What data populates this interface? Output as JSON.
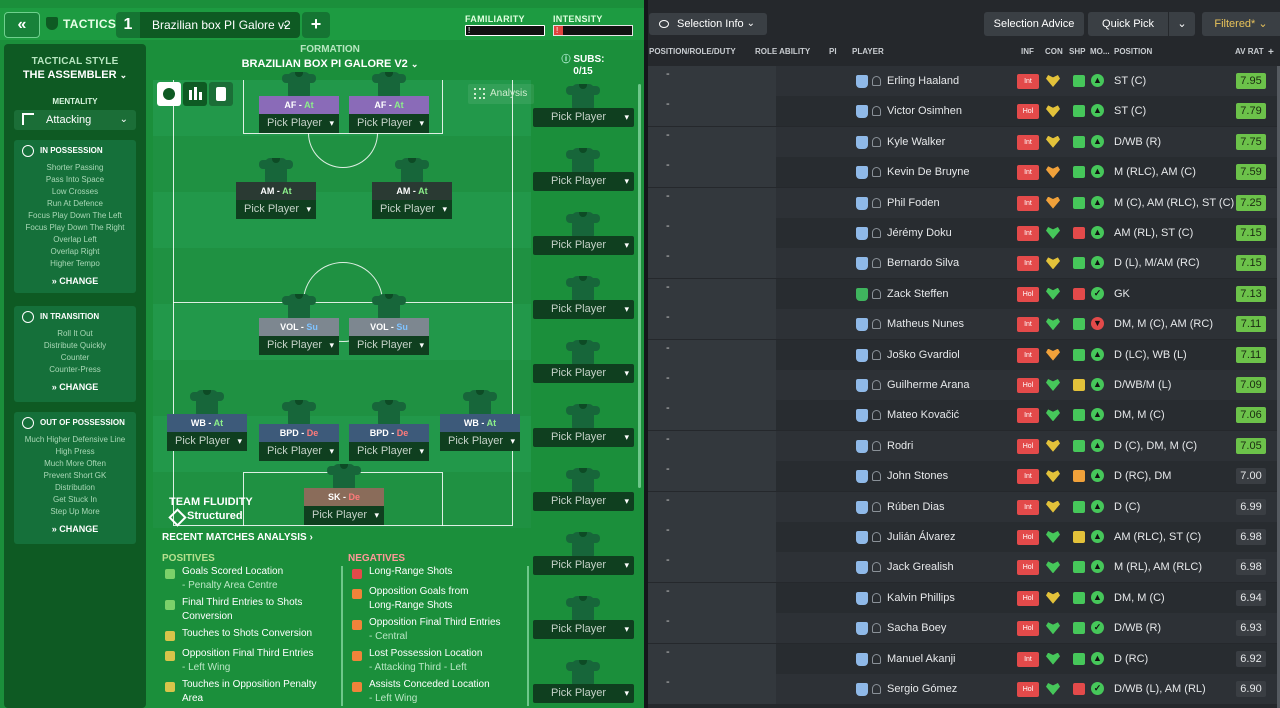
{
  "header": {
    "back_label": "«",
    "tactics_label": "TACTICS",
    "slot_number": "1",
    "tactic_name": "Brazilian box PI Galore v2",
    "add_label": "+",
    "familiarity_label": "FAMILIARITY",
    "familiarity_value": "!",
    "intensity_label": "INTENSITY",
    "intensity_value": "!",
    "intensity_level": 0.12
  },
  "style": {
    "label": "TACTICAL STYLE",
    "name": "THE ASSEMBLER",
    "mentality_label": "MENTALITY",
    "mentality_value": "Attacking",
    "in_possession": {
      "title": "IN POSSESSION",
      "items": [
        "Shorter Passing",
        "Pass Into Space",
        "Low Crosses",
        "Run At Defence",
        "Focus Play Down The Left",
        "Focus Play Down The Right",
        "Overlap Left",
        "Overlap Right",
        "Higher Tempo"
      ],
      "change": "CHANGE"
    },
    "in_transition": {
      "title": "IN TRANSITION",
      "items": [
        "Roll It Out",
        "Distribute Quickly",
        "Counter",
        "Counter-Press"
      ],
      "change": "CHANGE"
    },
    "out_of_possession": {
      "title": "OUT OF POSSESSION",
      "items": [
        "Much Higher Defensive Line",
        "High Press",
        "Much More Often",
        "Prevent Short GK",
        "Distribution",
        "Get Stuck In",
        "Step Up More"
      ],
      "change": "CHANGE"
    }
  },
  "formation": {
    "label": "FORMATION",
    "name": "BRAZILIAN BOX PI GALORE V2",
    "analysis_label": "Analysis",
    "subs_label": "SUBS:",
    "subs_count": "0/15",
    "pick_label": "Pick Player",
    "positions": [
      {
        "role": "AF",
        "duty": "At"
      },
      {
        "role": "AF",
        "duty": "At"
      },
      {
        "role": "AM",
        "duty": "At"
      },
      {
        "role": "AM",
        "duty": "At"
      },
      {
        "role": "VOL",
        "duty": "Su"
      },
      {
        "role": "VOL",
        "duty": "Su"
      },
      {
        "role": "WB",
        "duty": "At"
      },
      {
        "role": "BPD",
        "duty": "De"
      },
      {
        "role": "BPD",
        "duty": "De"
      },
      {
        "role": "WB",
        "duty": "At"
      },
      {
        "role": "SK",
        "duty": "De"
      }
    ],
    "fluidity_label": "TEAM FLUIDITY",
    "fluidity_value": "Structured"
  },
  "analysis": {
    "title": "RECENT MATCHES ANALYSIS",
    "positives_label": "POSITIVES",
    "negatives_label": "NEGATIVES",
    "positives": [
      {
        "text": "Goals Scored Location",
        "sub": "- Penalty Area Centre"
      },
      {
        "text": "Final Third Entries to Shots",
        "sub": "Conversion"
      },
      {
        "text": "Touches to Shots Conversion",
        "sub": ""
      },
      {
        "text": "Opposition Final Third Entries",
        "sub": "- Left Wing"
      },
      {
        "text": "Touches in Opposition Penalty",
        "sub": "Area"
      }
    ],
    "negatives": [
      {
        "text": "Long-Range Shots",
        "sub": ""
      },
      {
        "text": "Opposition Goals from",
        "sub": "Long-Range Shots"
      },
      {
        "text": "Opposition Final Third Entries",
        "sub": "- Central"
      },
      {
        "text": "Lost Possession Location",
        "sub": "- Attacking Third - Left"
      },
      {
        "text": "Assists Conceded Location",
        "sub": "- Left Wing"
      }
    ]
  },
  "selection": {
    "info_label": "Selection Info",
    "advice_label": "Selection Advice",
    "quick_pick_label": "Quick Pick",
    "filtered_label": "Filtered*",
    "columns": {
      "position": "POSITION/ROLE/DUTY",
      "role_ability": "ROLE ABILITY",
      "pi": "PI",
      "player": "PLAYER",
      "inf": "INF",
      "con": "CON",
      "shp": "SHP",
      "mor": "MO...",
      "pos": "POSITION",
      "rating": "AV RAT"
    },
    "players": [
      {
        "name": "Erling Haaland",
        "inf": "Int",
        "con": "yellow",
        "shp": "green",
        "mor": "up",
        "pos": "ST (C)",
        "rating": "7.95"
      },
      {
        "name": "Victor Osimhen",
        "inf": "Hol",
        "con": "yellow",
        "shp": "green",
        "mor": "up",
        "pos": "ST (C)",
        "rating": "7.79"
      },
      {
        "name": "Kyle Walker",
        "inf": "Int",
        "con": "yellow",
        "shp": "green",
        "mor": "up",
        "pos": "D/WB (R)",
        "rating": "7.75"
      },
      {
        "name": "Kevin De Bruyne",
        "inf": "Int",
        "con": "orange",
        "shp": "green",
        "mor": "up",
        "pos": "M (RLC), AM (C)",
        "rating": "7.59"
      },
      {
        "name": "Phil Foden",
        "inf": "Int",
        "con": "orange",
        "shp": "green",
        "mor": "up",
        "pos": "M (C), AM (RLC), ST (C)",
        "rating": "7.25"
      },
      {
        "name": "Jérémy Doku",
        "inf": "Int",
        "con": "green",
        "shp": "red",
        "mor": "up",
        "pos": "AM (RL), ST (C)",
        "rating": "7.15"
      },
      {
        "name": "Bernardo Silva",
        "inf": "Int",
        "con": "yellow",
        "shp": "green",
        "mor": "up",
        "pos": "D (L), M/AM (RC)",
        "rating": "7.15"
      },
      {
        "name": "Zack Steffen",
        "inf": "Hol",
        "con": "green",
        "shp": "red",
        "mor": "ok",
        "pos": "GK",
        "rating": "7.13",
        "gk": true
      },
      {
        "name": "Matheus Nunes",
        "inf": "Int",
        "con": "green",
        "shp": "green",
        "mor": "down",
        "pos": "DM, M (C), AM (RC)",
        "rating": "7.11"
      },
      {
        "name": "Joško Gvardiol",
        "inf": "Int",
        "con": "orange",
        "shp": "green",
        "mor": "up",
        "pos": "D (LC), WB (L)",
        "rating": "7.11"
      },
      {
        "name": "Guilherme Arana",
        "inf": "Hol",
        "con": "green",
        "shp": "yellow",
        "mor": "up",
        "pos": "D/WB/M (L)",
        "rating": "7.09"
      },
      {
        "name": "Mateo Kovačić",
        "inf": "Int",
        "con": "green",
        "shp": "green",
        "mor": "up",
        "pos": "DM, M (C)",
        "rating": "7.06"
      },
      {
        "name": "Rodri",
        "inf": "Hol",
        "con": "yellow",
        "shp": "green",
        "mor": "up",
        "pos": "D (C), DM, M (C)",
        "rating": "7.05"
      },
      {
        "name": "John Stones",
        "inf": "Int",
        "con": "yellow",
        "shp": "orange",
        "mor": "up",
        "pos": "D (RC), DM",
        "rating": "7.00"
      },
      {
        "name": "Rúben Dias",
        "inf": "Int",
        "con": "yellow",
        "shp": "green",
        "mor": "up",
        "pos": "D (C)",
        "rating": "6.99"
      },
      {
        "name": "Julián Álvarez",
        "inf": "Hol",
        "con": "green",
        "shp": "yellow",
        "mor": "up",
        "pos": "AM (RLC), ST (C)",
        "rating": "6.98"
      },
      {
        "name": "Jack Grealish",
        "inf": "Hol",
        "con": "green",
        "shp": "green",
        "mor": "up",
        "pos": "M (RL), AM (RLC)",
        "rating": "6.98"
      },
      {
        "name": "Kalvin Phillips",
        "inf": "Hol",
        "con": "yellow",
        "shp": "green",
        "mor": "up",
        "pos": "DM, M (C)",
        "rating": "6.94"
      },
      {
        "name": "Sacha Boey",
        "inf": "Hol",
        "con": "green",
        "shp": "green",
        "mor": "ok",
        "pos": "D/WB (R)",
        "rating": "6.93"
      },
      {
        "name": "Manuel Akanji",
        "inf": "Int",
        "con": "green",
        "shp": "green",
        "mor": "up",
        "pos": "D (RC)",
        "rating": "6.92"
      },
      {
        "name": "Sergio Gómez",
        "inf": "Hol",
        "con": "green",
        "shp": "red",
        "mor": "ok",
        "pos": "D/WB (L), AM (RL)",
        "rating": "6.90"
      }
    ]
  },
  "colors": {
    "green": "#46c75a",
    "yellow": "#e3c23a",
    "orange": "#f0a13a",
    "red": "#e34a4a",
    "rating_high": "#6cc24a"
  }
}
